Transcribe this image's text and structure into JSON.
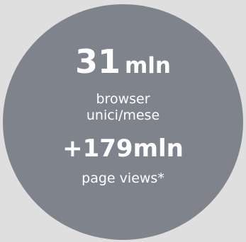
{
  "stat": {
    "main_value": "31",
    "main_unit": "mln",
    "label_line1": "browser",
    "label_line2": "unici/mese",
    "secondary_value": "+179mln",
    "secondary_label": "page views*"
  }
}
